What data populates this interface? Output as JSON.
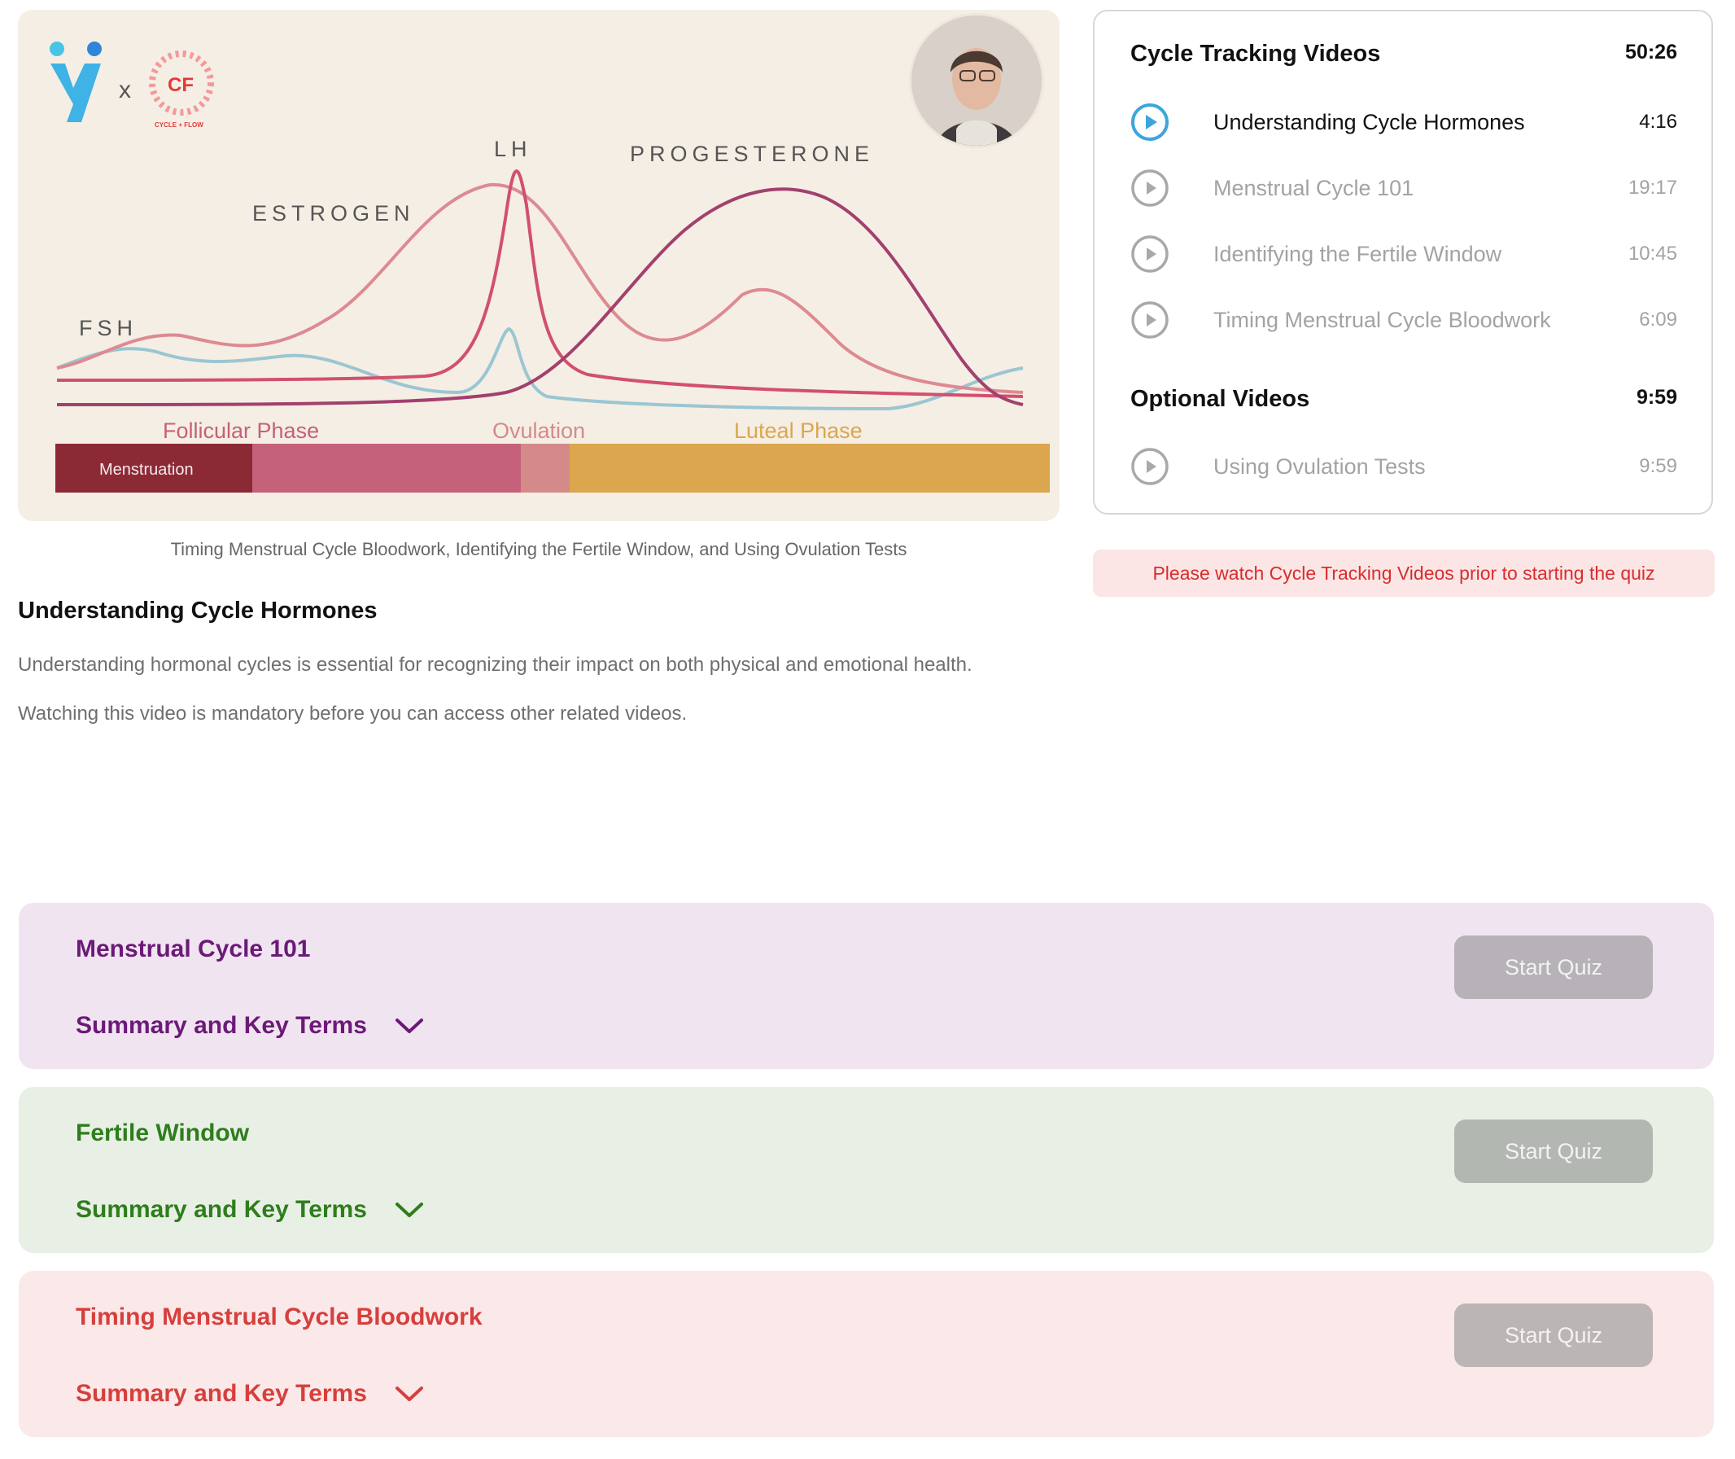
{
  "video": {
    "chart_labels": {
      "fsh": "FSH",
      "estrogen": "ESTROGEN",
      "lh": "LH",
      "progesterone": "PROGESTERONE",
      "follicular": "Follicular Phase",
      "ovulation": "Ovulation",
      "luteal": "Luteal Phase",
      "menstruation": "Menstruation"
    },
    "brand": {
      "x_mark": "x",
      "partner_logo_text": "CF",
      "partner_logo_sub": "CYCLE + FLOW"
    },
    "caption": "Timing Menstrual Cycle Bloodwork, Identifying the Fertile Window, and Using Ovulation Tests",
    "title": "Understanding Cycle Hormones",
    "description": [
      "Understanding hormonal cycles is essential for recognizing their impact on both physical and emotional health.",
      "Watching this video is mandatory before you can access other related videos."
    ]
  },
  "playlist": {
    "sections": [
      {
        "title": "Cycle Tracking Videos",
        "duration": "50:26",
        "items": [
          {
            "label": "Understanding Cycle Hormones",
            "time": "4:16",
            "active": true
          },
          {
            "label": "Menstrual Cycle 101",
            "time": "19:17",
            "active": false
          },
          {
            "label": "Identifying the Fertile Window",
            "time": "10:45",
            "active": false
          },
          {
            "label": "Timing Menstrual Cycle Bloodwork",
            "time": "6:09",
            "active": false
          }
        ]
      },
      {
        "title": "Optional Videos",
        "duration": "9:59",
        "items": [
          {
            "label": "Using Ovulation Tests",
            "time": "9:59",
            "active": false
          }
        ]
      }
    ],
    "warning": "Please watch Cycle Tracking Videos prior to starting the quiz"
  },
  "quiz_cards": [
    {
      "title": "Menstrual Cycle 101",
      "summary": "Summary and Key Terms",
      "button": "Start Quiz",
      "color": "#6b1a78"
    },
    {
      "title": "Fertile Window",
      "summary": "Summary and Key Terms",
      "button": "Start Quiz",
      "color": "#2f7d1c"
    },
    {
      "title": "Timing Menstrual Cycle Bloodwork",
      "summary": "Summary and Key Terms",
      "button": "Start Quiz",
      "color": "#d63f3d"
    }
  ],
  "colors": {
    "accent_blue": "#3ca6dc",
    "menstruation": "#8b2a35",
    "follicular": "#c5617a",
    "ovulation": "#d58a8a",
    "luteal": "#dca64f"
  }
}
